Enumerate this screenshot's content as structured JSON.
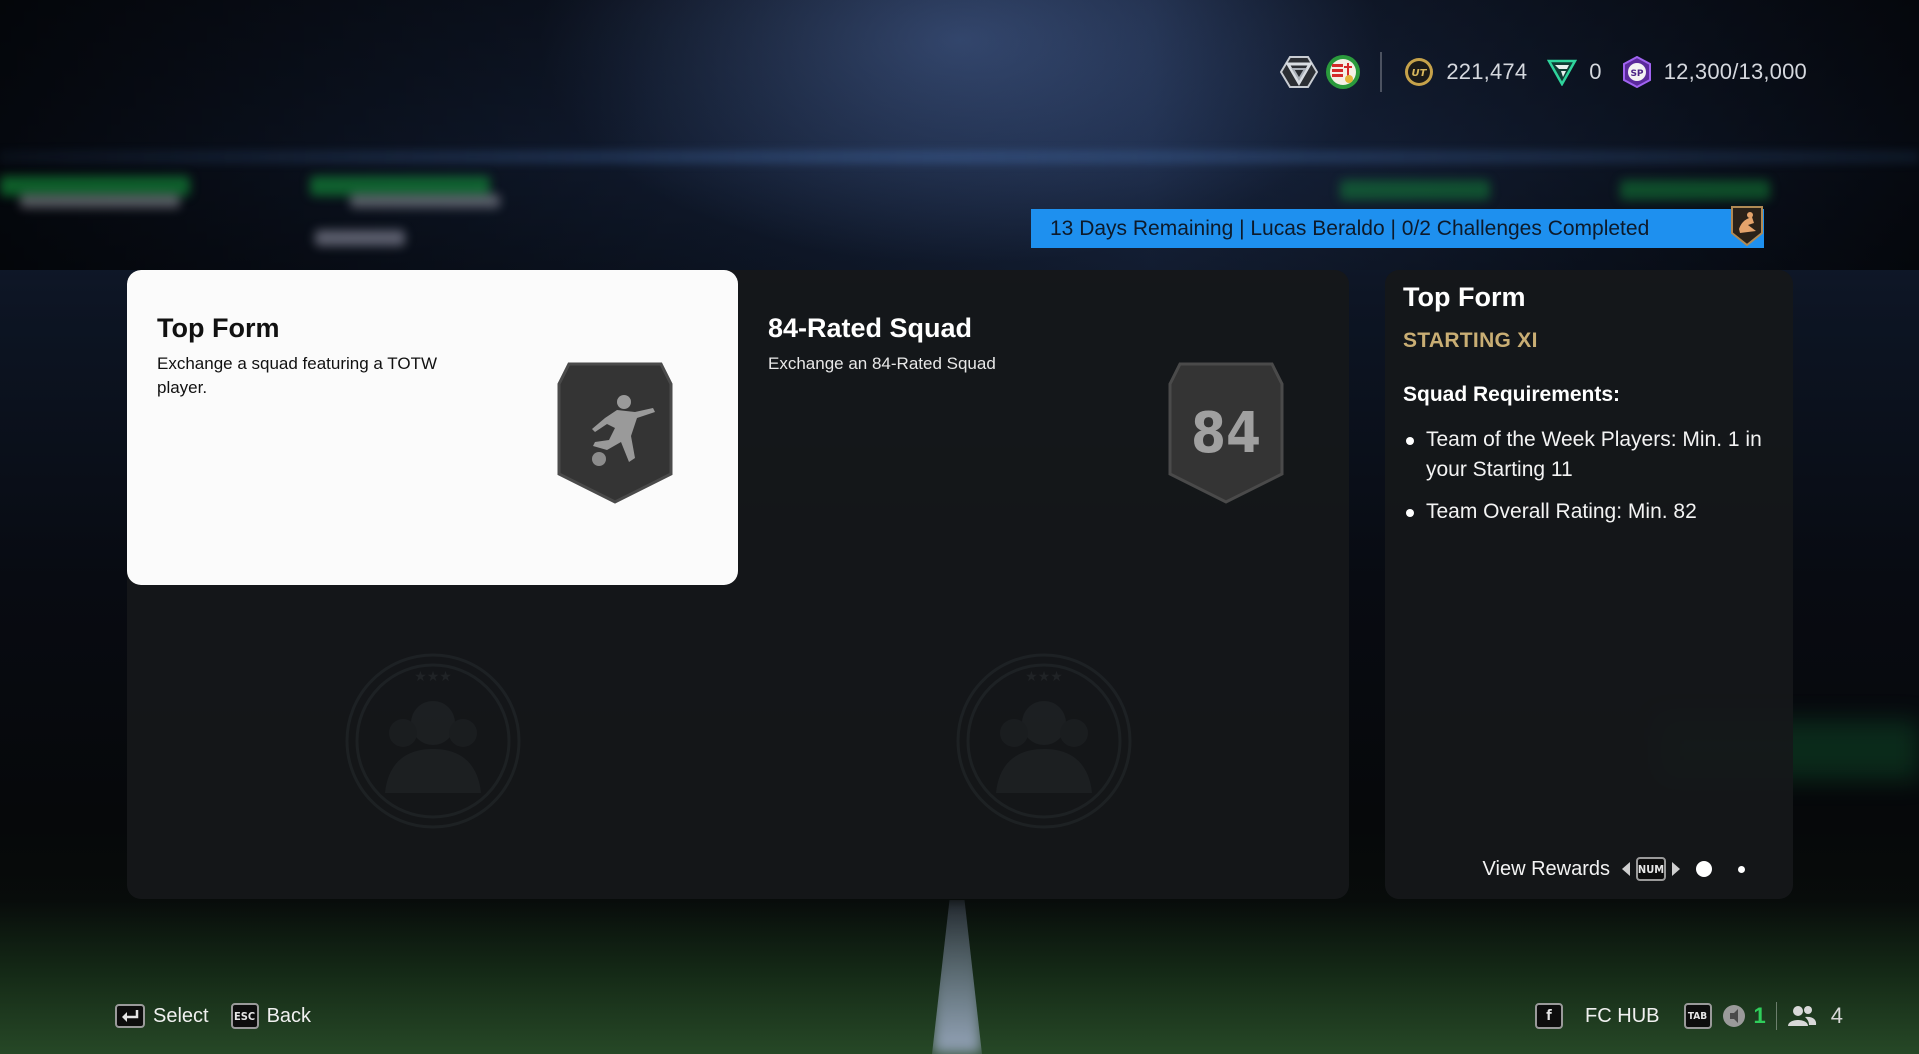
{
  "header": {
    "icons": [
      "season-rank-icon",
      "club-badge-icon"
    ],
    "currencies": [
      {
        "icon": "coins-icon",
        "label": "UT",
        "value": "221,474"
      },
      {
        "icon": "fc-points-icon",
        "value": "0"
      },
      {
        "icon": "season-points-icon",
        "label": "SP",
        "value": "12,300/13,000"
      }
    ]
  },
  "banner": {
    "text": "13 Days Remaining | Lucas Beraldo | 0/2 Challenges Completed",
    "color": "#1e90ef",
    "badge_icon": "player-reward-badge-icon"
  },
  "challenges": [
    {
      "title": "Top Form",
      "description": "Exchange a squad featuring a TOTW player.",
      "badge_icon": "kicking-player-icon",
      "selected": true
    },
    {
      "title": "84-Rated Squad",
      "description": "Exchange an 84-Rated Squad",
      "badge_text": "84",
      "selected": false
    }
  ],
  "detail": {
    "title": "Top Form",
    "subtitle": "STARTING XI",
    "subtitle_color": "#c9ae74",
    "requirements_heading": "Squad Requirements:",
    "requirements": [
      "Team of the Week Players: Min. 1 in your Starting 11",
      "Team Overall Rating: Min. 82"
    ],
    "view_rewards_label": "View Rewards",
    "view_rewards_key": "NUM",
    "page_count": 2,
    "page_active": 1
  },
  "footer": {
    "left": [
      {
        "key": "enter-key-icon",
        "label": "Select"
      },
      {
        "key": "ESC",
        "label": "Back"
      }
    ],
    "right": {
      "fc_hub_key": "f",
      "fc_hub_label": "FC HUB",
      "tab_key": "TAB",
      "notifications_count": "1",
      "friends_count": "4"
    }
  }
}
